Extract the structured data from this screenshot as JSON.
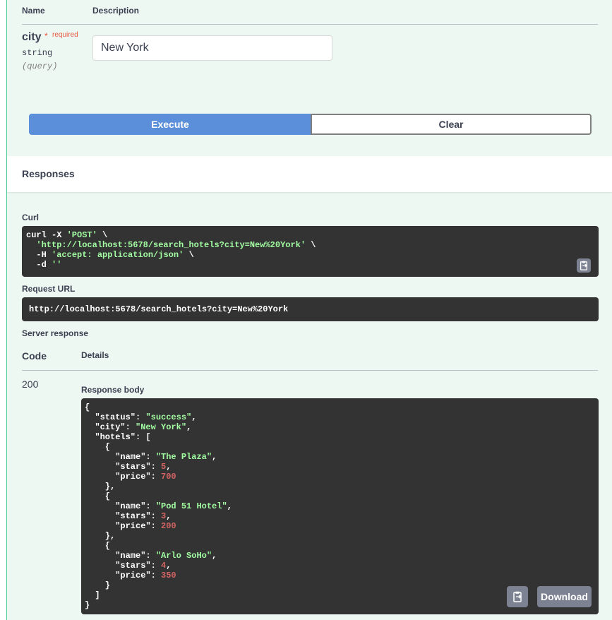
{
  "parameters": {
    "header_name": "Name",
    "header_description": "Description",
    "items": [
      {
        "name": "city",
        "required_star": "*",
        "required_label": "required",
        "type": "string",
        "in": "(query)",
        "value": "New York"
      }
    ]
  },
  "actions": {
    "execute_label": "Execute",
    "clear_label": "Clear"
  },
  "responses": {
    "title": "Responses",
    "curl_label": "Curl",
    "curl_lines": {
      "l1_cmd": "curl -X ",
      "l1_str": "'POST'",
      "l1_end": " \\",
      "l2_str": "'http://localhost:5678/search_hotels?city=New%20York'",
      "l2_end": " \\",
      "l3_cmd": "-H ",
      "l3_str": "'accept: application/json'",
      "l3_end": " \\",
      "l4_cmd": "-d ",
      "l4_str": "''"
    },
    "request_url_label": "Request URL",
    "request_url": "http://localhost:5678/search_hotels?city=New%20York",
    "server_response_label": "Server response",
    "code_header": "Code",
    "details_header": "Details",
    "code": "200",
    "response_body_label": "Response body",
    "download_label": "Download",
    "body": {
      "status": "success",
      "city": "New York",
      "hotels": [
        {
          "name": "The Plaza",
          "stars": "5",
          "price": "700"
        },
        {
          "name": "Pod 51 Hotel",
          "stars": "3",
          "price": "200"
        },
        {
          "name": "Arlo SoHo",
          "stars": "4",
          "price": "350"
        }
      ]
    }
  },
  "icons": {
    "curl_copy": "clipboard-icon",
    "body_copy": "clipboard-icon"
  },
  "colors": {
    "execute": "#5b8fd9",
    "string": "#a2fca2",
    "number": "#d36363",
    "required": "#e8573f",
    "panel_bg": "#eef8f3",
    "accent_border": "#49cc90"
  }
}
